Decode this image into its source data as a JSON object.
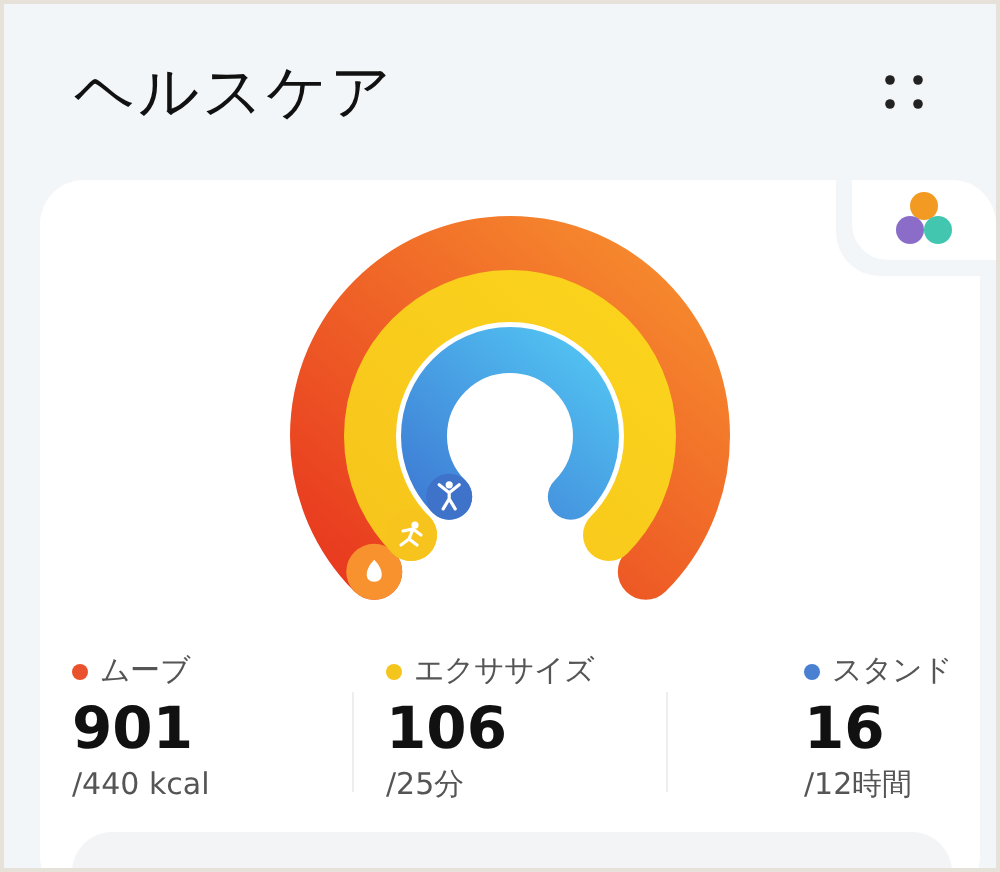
{
  "title": "ヘルスケア",
  "metrics": [
    {
      "kind": "move",
      "label": "ムーブ",
      "value": "901",
      "goal": "/440 kcal",
      "color": "#e9522c"
    },
    {
      "kind": "exercise",
      "label": "エクササイズ",
      "value": "106",
      "goal": "/25分",
      "color": "#f4c51c"
    },
    {
      "kind": "stand",
      "label": "スタンド",
      "value": "16",
      "goal": "/12時間",
      "color": "#4a80d2"
    }
  ]
}
